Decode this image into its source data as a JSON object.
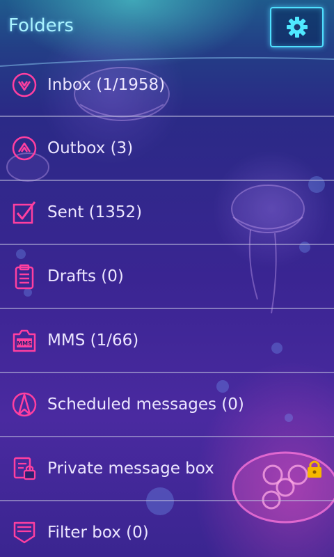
{
  "header": {
    "title": "Folders",
    "settings_icon": "gear-icon"
  },
  "folders": [
    {
      "label": "Inbox (1/1958)",
      "icon": "inbox-down-arrow-icon"
    },
    {
      "label": "Outbox (3)",
      "icon": "outbox-up-arrow-icon"
    },
    {
      "label": "Sent (1352)",
      "icon": "checkbox-check-icon"
    },
    {
      "label": "Drafts (0)",
      "icon": "clipboard-icon"
    },
    {
      "label": "MMS (1/66)",
      "icon": "mms-icon"
    },
    {
      "label": "Scheduled messages (0)",
      "icon": "scheduled-icon"
    },
    {
      "label": "Private message box",
      "icon": "private-box-icon",
      "locked": true
    },
    {
      "label": "Filter box (0)",
      "icon": "filter-box-icon"
    }
  ],
  "mms_icon_text": "MMS",
  "colors": {
    "accent": "#ff3fa0",
    "header_text": "#a9f3ff",
    "settings_border": "#4fe0ff",
    "row_text": "#ece6ff",
    "divider": "#c0c0dc",
    "lock": "#f5b800"
  }
}
